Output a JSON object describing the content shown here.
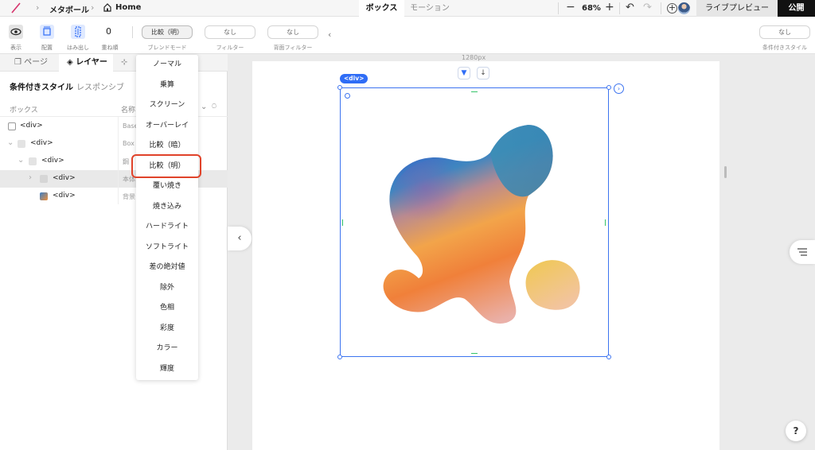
{
  "breadcrumb": {
    "project": "メタボール",
    "page": "Home"
  },
  "top_tabs": [
    {
      "label": "ボックス"
    },
    {
      "label": "モーション"
    }
  ],
  "zoom": {
    "minus": "−",
    "value": "68%",
    "plus": "+"
  },
  "actions": {
    "live_preview": "ライブプレビュー",
    "publish": "公開"
  },
  "toolbar": {
    "display_label": "表示",
    "placement_label": "配置",
    "overflow_label": "はみ出し",
    "z_order_value": "0",
    "z_order_label": "重ね順",
    "blend_mode_value": "比較（明）",
    "blend_mode_label": "ブレンドモード",
    "filter_value": "なし",
    "filter_label": "フィルター",
    "backdrop_filter_value": "なし",
    "backdrop_filter_label": "背面フィルター",
    "conditional_value": "なし",
    "conditional_label": "条件付きスタイル"
  },
  "left_panel": {
    "tabs": [
      {
        "label": "ページ"
      },
      {
        "label": "レイヤー"
      },
      {
        "label": "追加"
      }
    ],
    "sub_tabs": [
      {
        "label": "条件付きスタイル"
      },
      {
        "label": "レスポンシブ"
      }
    ],
    "col_box": "ボックス",
    "col_name": "名称",
    "rows": [
      {
        "tag": "<div>",
        "name": "Base"
      },
      {
        "tag": "<div>",
        "name": "Box"
      },
      {
        "tag": "<div>",
        "name": "鋼"
      },
      {
        "tag": "<div>",
        "name": "本体"
      },
      {
        "tag": "<div>",
        "name": "背景"
      }
    ]
  },
  "blend_menu": [
    "ノーマル",
    "乗算",
    "スクリーン",
    "オーバーレイ",
    "比較（暗）",
    "比較（明）",
    "覆い焼き",
    "焼き込み",
    "ハードライト",
    "ソフトライト",
    "差の絶対値",
    "除外",
    "色相",
    "彩度",
    "カラー",
    "輝度"
  ],
  "blend_menu_selected_index": 5,
  "canvas": {
    "width_label": "1280px",
    "selected_badge": "<div>"
  },
  "help": {
    "label": "?"
  },
  "colors": {
    "accent": "#2f6df6",
    "highlight": "#e0432a",
    "publish_bg": "#111111"
  }
}
